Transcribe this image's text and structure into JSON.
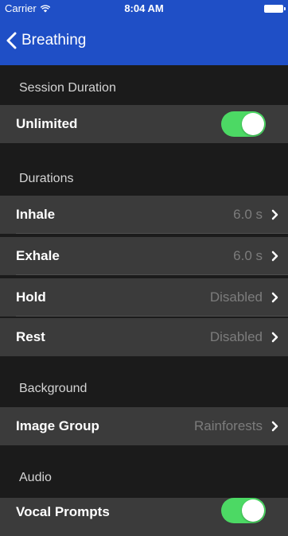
{
  "status_bar": {
    "carrier": "Carrier",
    "time": "8:04 AM"
  },
  "nav": {
    "back_label": "Breathing"
  },
  "sections": {
    "session_duration": {
      "header": "Session Duration",
      "unlimited_label": "Unlimited",
      "unlimited_on": true
    },
    "durations": {
      "header": "Durations",
      "rows": [
        {
          "label": "Inhale",
          "value": "6.0 s"
        },
        {
          "label": "Exhale",
          "value": "6.0 s"
        },
        {
          "label": "Hold",
          "value": "Disabled"
        },
        {
          "label": "Rest",
          "value": "Disabled"
        }
      ]
    },
    "background": {
      "header": "Background",
      "image_group_label": "Image Group",
      "image_group_value": "Rainforests"
    },
    "audio": {
      "header": "Audio",
      "vocal_prompts_label": "Vocal Prompts",
      "vocal_prompts_on": true
    }
  },
  "colors": {
    "nav_blue": "#1f4fc6",
    "toggle_green": "#4cd964",
    "cell_bg": "#3b3b3b",
    "page_bg": "#1b1b1b"
  }
}
